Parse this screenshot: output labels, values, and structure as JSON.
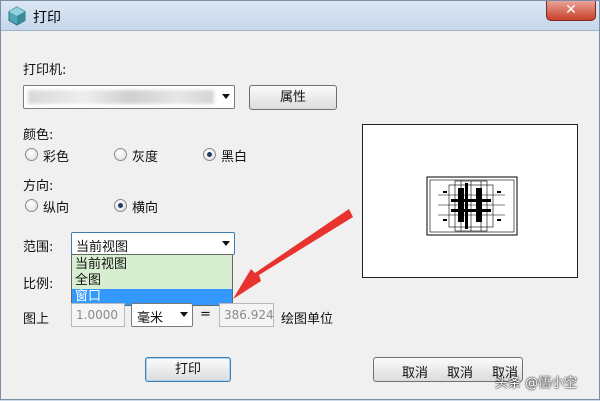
{
  "window": {
    "title": "打印",
    "close_glyph": "✕"
  },
  "printer": {
    "label": "打印机:",
    "properties_button": "属性"
  },
  "color": {
    "label": "颜色:",
    "options": [
      {
        "label": "彩色",
        "checked": false
      },
      {
        "label": "灰度",
        "checked": false
      },
      {
        "label": "黑白",
        "checked": true
      }
    ]
  },
  "orientation": {
    "label": "方向:",
    "options": [
      {
        "label": "纵向",
        "checked": false
      },
      {
        "label": "横向",
        "checked": true
      }
    ]
  },
  "range": {
    "label": "范围:",
    "selected": "当前视图",
    "options": [
      "当前视图",
      "全图",
      "窗口"
    ],
    "highlighted_option": "窗口"
  },
  "scale": {
    "label": "比例:",
    "prefix_label": "图上",
    "value": "1.0000",
    "unit": "毫米",
    "equals": "=",
    "drawing_value": "386.924",
    "suffix_label": "绘图单位"
  },
  "buttons": {
    "print": "打印",
    "cancel1": "取消",
    "cancel2": "取消",
    "cancel3": "取消"
  },
  "watermark": "头条 @悟小空",
  "colors": {
    "arrow": "#e8322d",
    "highlight": "#3399ff",
    "dropdown_bg": "#d8eed0"
  }
}
